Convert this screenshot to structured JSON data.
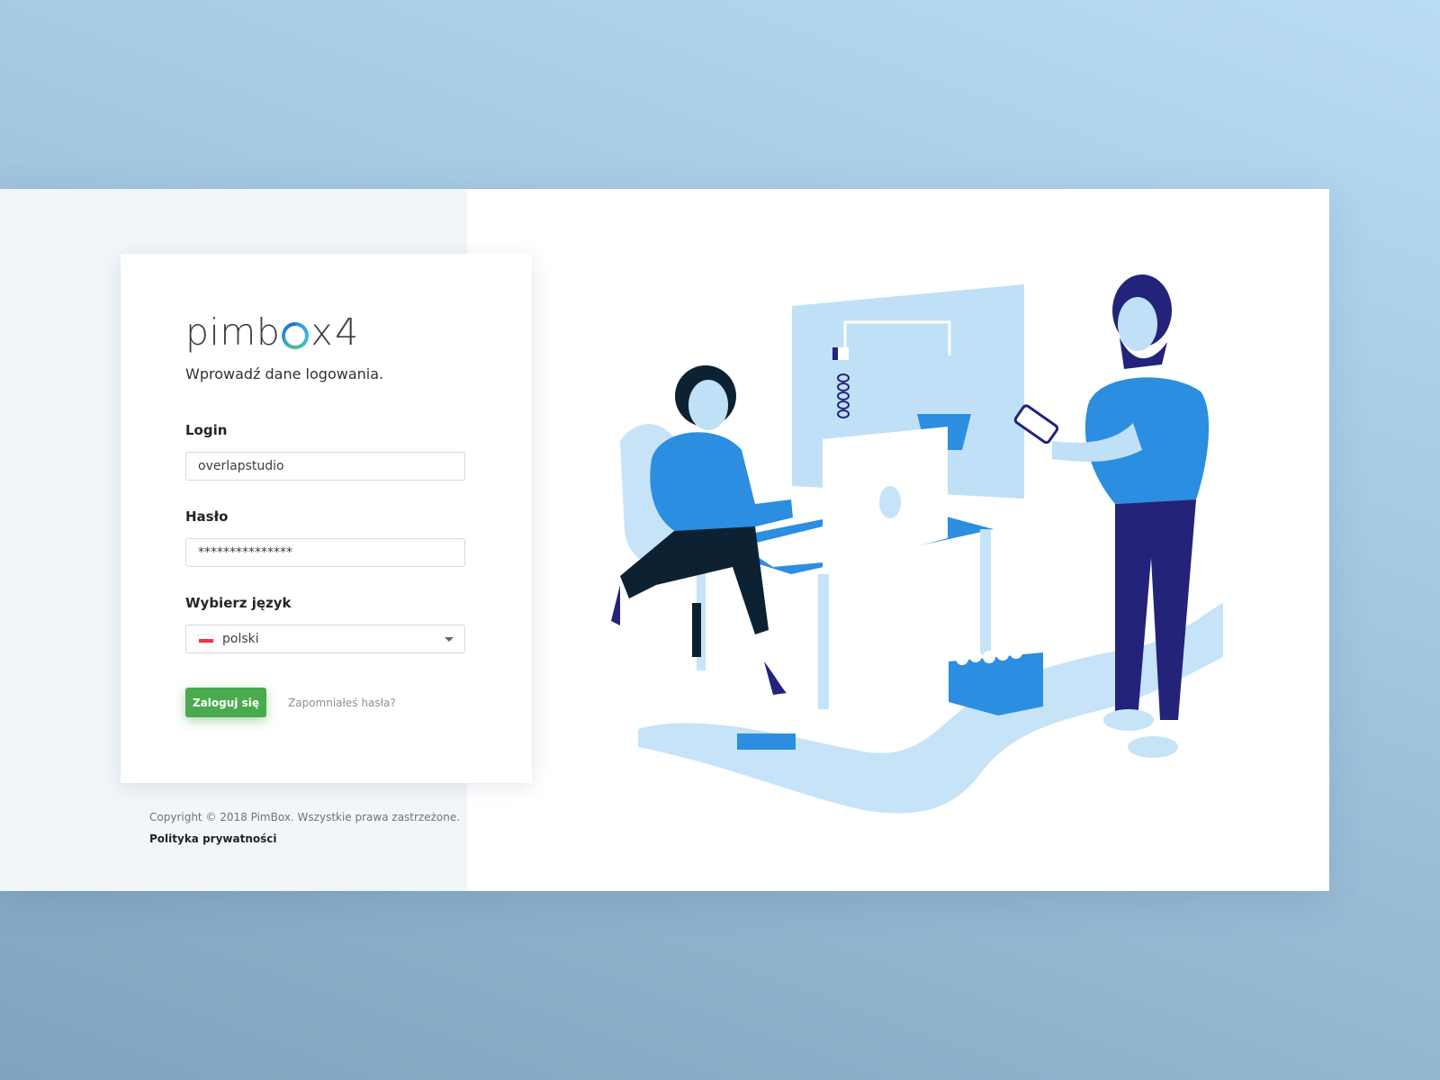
{
  "brand": {
    "logo_prefix": "pimb",
    "logo_suffix": "x",
    "logo_version": "4"
  },
  "form": {
    "subtitle": "Wprowadź dane logowania.",
    "login_label": "Login",
    "login_value": "overlapstudio",
    "password_label": "Hasło",
    "password_value": "***************",
    "language_label": "Wybierz język",
    "language_value": "polski",
    "submit_label": "Zaloguj się",
    "forgot_label": "Zapomniałeś hasła?"
  },
  "footer": {
    "copyright": "Copyright © 2018 PimBox. Wszystkie prawa zastrzeżone.",
    "privacy_link": "Polityka prywatności"
  },
  "colors": {
    "primary_button": "#4aaa4e",
    "illustration_blue": "#2b8ee0",
    "illustration_navy": "#23237a",
    "illustration_light": "#bfe0f7"
  },
  "icons": {
    "language_flag": "poland-flag-icon",
    "select_caret": "chevron-down-icon"
  }
}
